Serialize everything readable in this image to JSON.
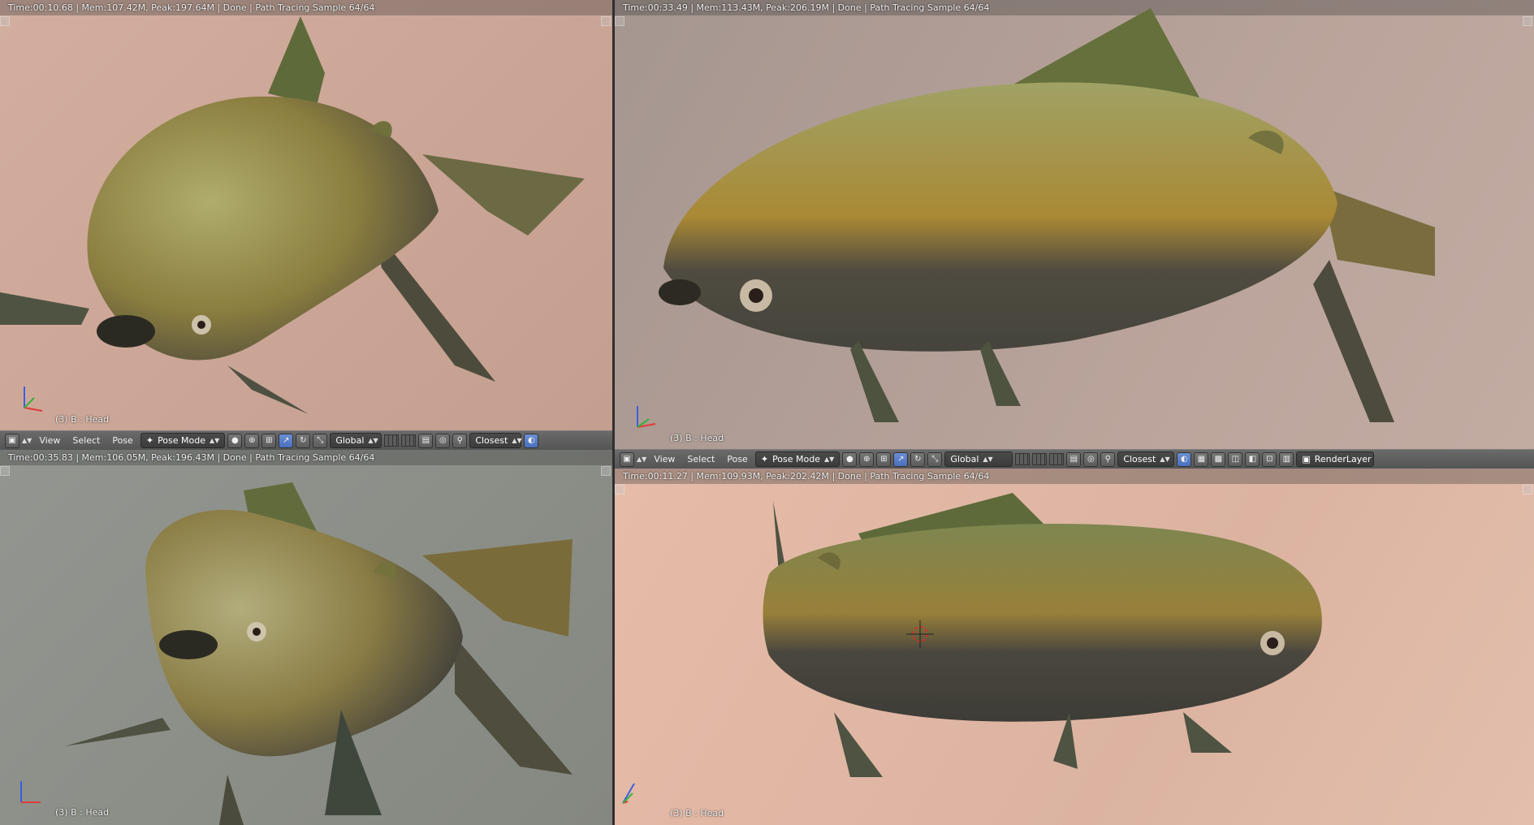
{
  "viewports": {
    "top_left": {
      "status": "Time:00:10.68 | Mem:107.42M, Peak:197.64M | Done | Path Tracing Sample 64/64",
      "label": "(3) B : Head",
      "bg": "#c9a798"
    },
    "top_right": {
      "status": "Time:00:33.49 | Mem:113.43M, Peak:206.19M | Done | Path Tracing Sample 64/64",
      "label": "(3) B : Head",
      "bg": "#b29c95"
    },
    "bottom_left": {
      "status": "Time:00:35.83 | Mem:106.05M, Peak:196.43M | Done | Path Tracing Sample 64/64",
      "label": "(3) B : Head",
      "bg": "#8c8f88"
    },
    "bottom_right": {
      "status": "Time:00:11.27 | Mem:109.93M, Peak:202.42M | Done | Path Tracing Sample 64/64",
      "label": "(3) B : Head",
      "bg": "#e2b9a6"
    }
  },
  "toolbar_left": {
    "view": "View",
    "select": "Select",
    "pose": "Pose",
    "mode": "Pose Mode",
    "orientation": "Global",
    "snap": "Closest"
  },
  "toolbar_right": {
    "view": "View",
    "select": "Select",
    "pose": "Pose",
    "mode": "Pose Mode",
    "orientation": "Global",
    "snap": "Closest",
    "render_layer": "RenderLayer"
  },
  "axis_labels": {
    "x": "x",
    "y": "y",
    "z": "z"
  },
  "colors": {
    "fish_body": "#8a8a4a",
    "fish_gold": "#a48a3a",
    "fish_dark": "#4d4a3f",
    "fin": "#5e5f48"
  }
}
